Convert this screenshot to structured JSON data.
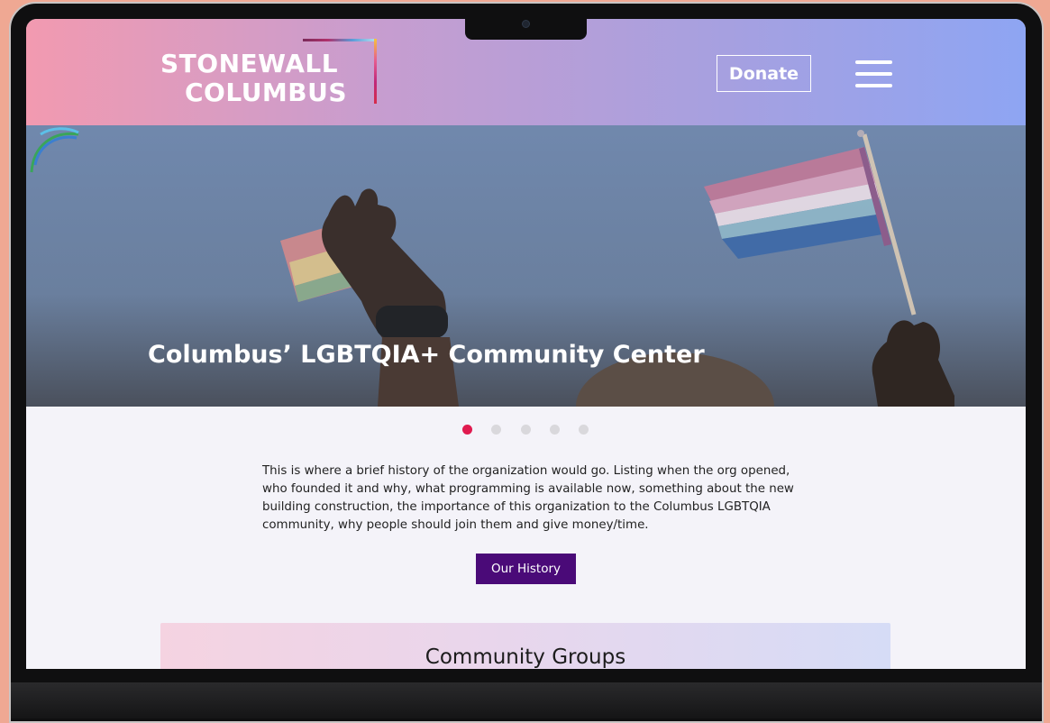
{
  "header": {
    "logo_line1": "STONEWALL",
    "logo_line2": "COLUMBUS",
    "donate_label": "Donate",
    "menu_icon": "hamburger-menu-icon"
  },
  "hero": {
    "title": "Columbus’ LGBTQIA+ Community Center",
    "carousel": {
      "slide_count": 5,
      "active_index": 0
    }
  },
  "intro": {
    "text": "This is where a brief history of the organization would go. Listing when the org opened, who founded it and why, what programming is available now, something about the new building construction,  the importance of this organization to the Columbus LGBTQIA community, why people should join them and give money/time.",
    "button_label": "Our History"
  },
  "groups": {
    "title": "Community Groups"
  },
  "colors": {
    "accent_dot": "#e01a4f",
    "button_purple": "#4a0a78",
    "header_gradient_start": "#f29ab0",
    "header_gradient_end": "#8ea5f3"
  }
}
